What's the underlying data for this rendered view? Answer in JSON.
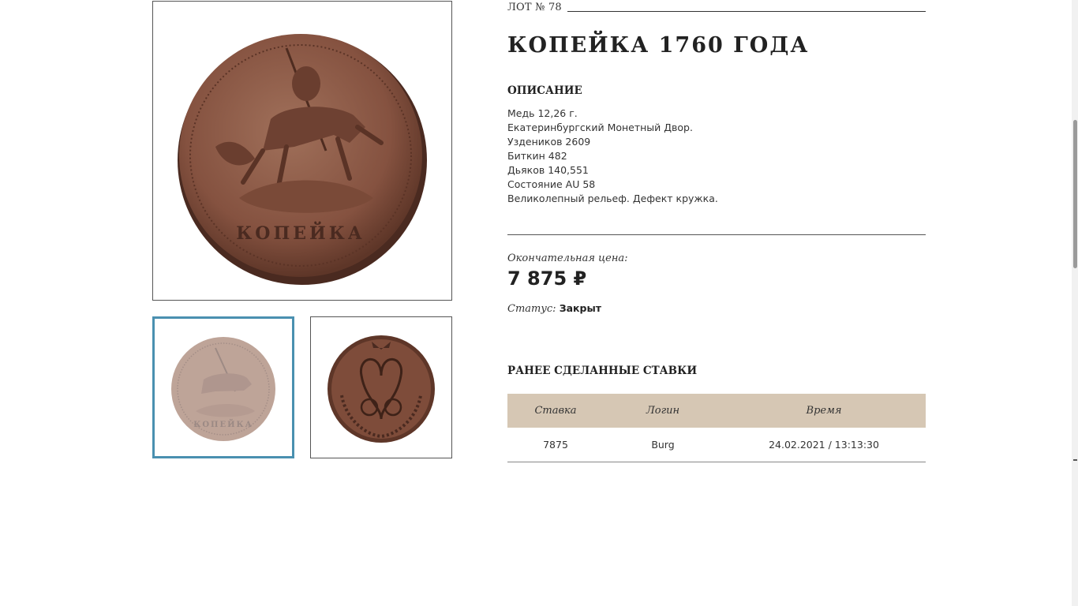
{
  "lot": {
    "label": "ЛОТ № 78"
  },
  "title": "КОПЕЙКА 1760 ГОДА",
  "description": {
    "heading": "ОПИСАНИЕ",
    "lines": [
      "Медь 12,26 г.",
      "Екатеринбургский Монетный Двор.",
      "Уздеников 2609",
      "Биткин 482",
      "Дьяков 140,551",
      "Состояние AU 58",
      "Великолепный рельеф. Дефект кружка."
    ]
  },
  "price": {
    "label": "Окончательная цена:",
    "value": "7 875 ₽"
  },
  "status": {
    "label": "Статус:",
    "value": "Закрыт"
  },
  "bids": {
    "heading": "РАНЕЕ СДЕЛАННЫЕ СТАВКИ",
    "columns": [
      "Ставка",
      "Логин",
      "Время"
    ],
    "rows": [
      {
        "bid": "7875",
        "login": "Burg",
        "time": "24.02.2021 / 13:13:30"
      }
    ]
  },
  "gallery": {
    "main_image": "coin-obverse-image",
    "thumbnails": [
      "coin-obverse-thumbnail",
      "coin-reverse-thumbnail"
    ],
    "selected_index": 0
  },
  "colors": {
    "table_header_bg": "#d6c7b4",
    "thumbnail_selected_border": "#4a90b0",
    "coin_copper": "#8a5a45"
  }
}
